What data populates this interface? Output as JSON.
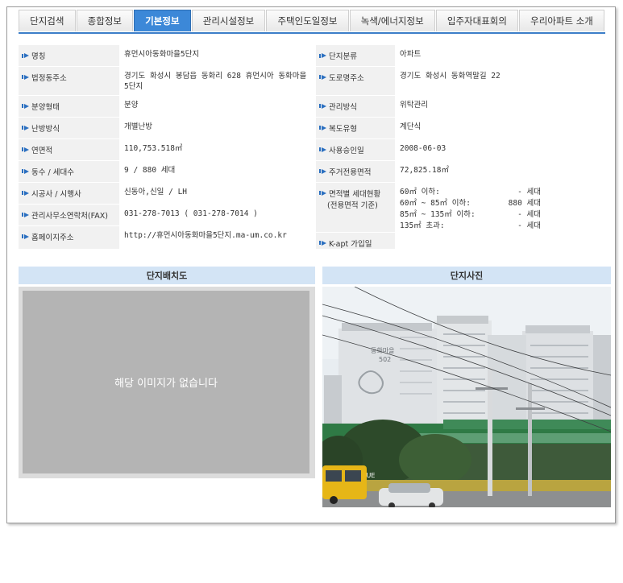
{
  "tabs": [
    {
      "label": "단지검색",
      "active": false
    },
    {
      "label": "종합정보",
      "active": false
    },
    {
      "label": "기본정보",
      "active": true
    },
    {
      "label": "관리시설정보",
      "active": false
    },
    {
      "label": "주택인도일정보",
      "active": false
    },
    {
      "label": "녹색/에너지정보",
      "active": false
    },
    {
      "label": "입주자대표회의",
      "active": false
    },
    {
      "label": "우리아파트 소개",
      "active": false
    }
  ],
  "info": {
    "name_label": "명칭",
    "name_value": "휴먼시아동화마을5단지",
    "category_label": "단지분류",
    "category_value": "아파트",
    "legal_addr_label": "법정동주소",
    "legal_addr_value": "경기도 화성시 봉담읍 동화리 628 휴먼시아 동화마을 5단지",
    "road_addr_label": "도로명주소",
    "road_addr_value": "경기도 화성시 동화역말길 22",
    "sale_label": "분양형태",
    "sale_value": "분양",
    "mgmt_label": "관리방식",
    "mgmt_value": "위탁관리",
    "heating_label": "난방방식",
    "heating_value": "개별난방",
    "corridor_label": "복도유형",
    "corridor_value": "계단식",
    "floor_area_label": "연면적",
    "floor_area_value": "110,753.518㎡",
    "approval_label": "사용승인일",
    "approval_value": "2008-06-03",
    "buildings_label": "동수 / 세대수",
    "buildings_value": "9 / 880 세대",
    "excl_area_label": "주거전용면적",
    "excl_area_value": "72,825.18㎡",
    "builder_label": "시공사 / 시행사",
    "builder_value": "신동아,신일 / LH",
    "units_label": "면적별 세대현황",
    "units_label_sub": "(전용면적 기준)",
    "units": [
      {
        "range": "60㎡ 이하:",
        "count": "- 세대"
      },
      {
        "range": "60㎡ ~ 85㎡ 이하:",
        "count": "880 세대"
      },
      {
        "range": "85㎡ ~ 135㎡ 이하:",
        "count": "- 세대"
      },
      {
        "range": "135㎡ 초과:",
        "count": "- 세대"
      }
    ],
    "office_label": "관리사무소연락처(FAX)",
    "office_value": "031-278-7013 ( 031-278-7014 )",
    "homepage_label": "홈페이지주소",
    "homepage_value": "http://휴먼시아동화마을5단지.ma-um.co.kr",
    "kapt_label": "K-apt 가입일",
    "kapt_value": ""
  },
  "layout_section": {
    "title": "단지배치도",
    "no_image_text": "해당 이미지가 없습니다"
  },
  "photo_section": {
    "title": "단지사진",
    "building_sign_line1": "동화마을",
    "building_sign_line2": "502",
    "store_sign": "THE HUE"
  },
  "colors": {
    "accent": "#3c88d8",
    "section_header": "#d3e4f5",
    "label_bg": "#f1f1f1"
  }
}
